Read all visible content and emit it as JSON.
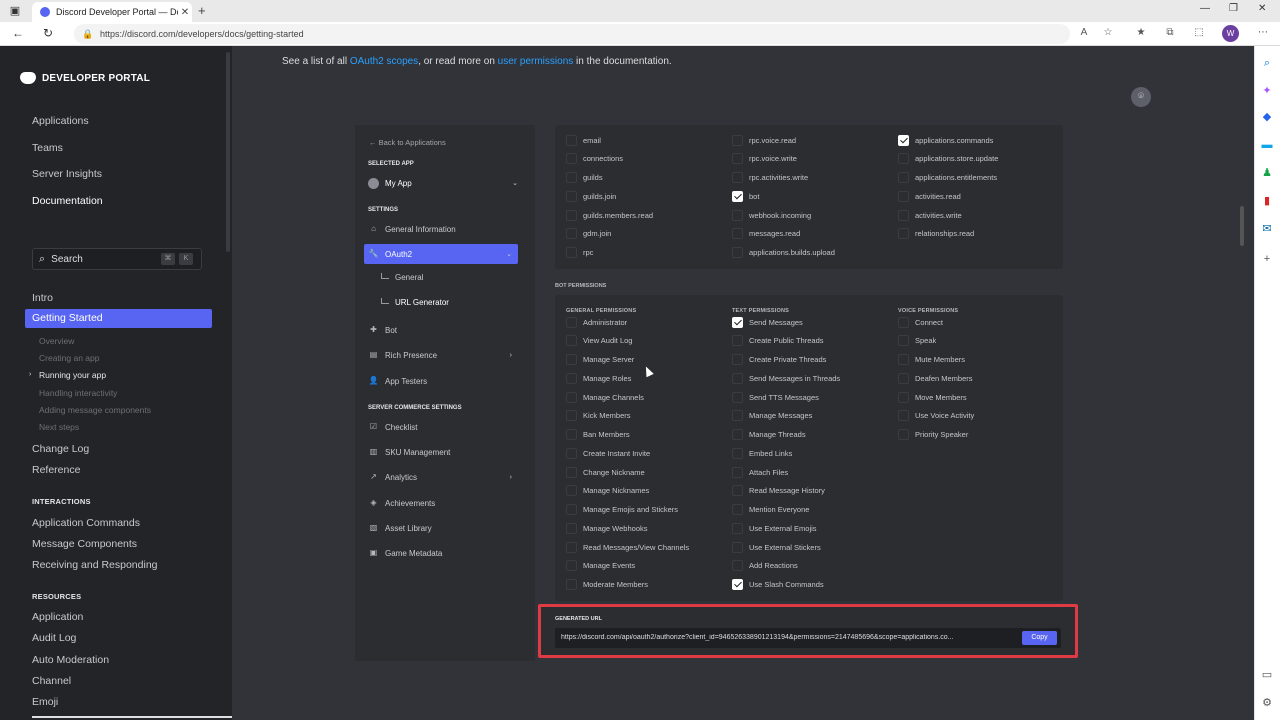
{
  "browser": {
    "tab_title": "Discord Developer Portal — Doc",
    "url": "https://discord.com/developers/docs/getting-started"
  },
  "sidebar": {
    "logo": "DEVELOPER PORTAL",
    "top_links": [
      "Applications",
      "Teams",
      "Server Insights",
      "Documentation"
    ],
    "search": {
      "placeholder": "Search",
      "kbd1": "⌘",
      "kbd2": "K"
    },
    "intro": "Intro",
    "active": "Getting Started",
    "sub_items": [
      "Overview",
      "Creating an app",
      "Running your app",
      "Handling interactivity",
      "Adding message components",
      "Next steps"
    ],
    "current_sub": "Running your app",
    "more_links": [
      "Change Log",
      "Reference"
    ],
    "interactions_heading": "INTERACTIONS",
    "interactions": [
      "Application Commands",
      "Message Components",
      "Receiving and Responding"
    ],
    "resources_heading": "RESOURCES",
    "resources": [
      "Application",
      "Audit Log",
      "Auto Moderation",
      "Channel",
      "Emoji"
    ]
  },
  "intro_line": {
    "pre": "See a list of all ",
    "link1": "OAuth2 scopes",
    "mid": ", or read more on ",
    "link2": "user permissions",
    "post": " in the documentation."
  },
  "app_nav": {
    "back": "Back to Applications",
    "selected_app_heading": "SELECTED APP",
    "app_name": "My App",
    "settings_heading": "SETTINGS",
    "general_information": "General Information",
    "oauth2": "OAuth2",
    "general": "General",
    "url_generator": "URL Generator",
    "bot": "Bot",
    "rich_presence": "Rich Presence",
    "app_testers": "App Testers",
    "commerce_heading": "SERVER COMMERCE SETTINGS",
    "checklist": "Checklist",
    "sku_management": "SKU Management",
    "analytics": "Analytics",
    "achievements": "Achievements",
    "asset_library": "Asset Library",
    "game_metadata": "Game Metadata"
  },
  "scopes": {
    "col1": [
      {
        "label": "email",
        "checked": false
      },
      {
        "label": "connections",
        "checked": false
      },
      {
        "label": "guilds",
        "checked": false
      },
      {
        "label": "guilds.join",
        "checked": false
      },
      {
        "label": "guilds.members.read",
        "checked": false
      },
      {
        "label": "gdm.join",
        "checked": false
      },
      {
        "label": "rpc",
        "checked": false
      }
    ],
    "col2": [
      {
        "label": "rpc.voice.read",
        "checked": false
      },
      {
        "label": "rpc.voice.write",
        "checked": false
      },
      {
        "label": "rpc.activities.write",
        "checked": false
      },
      {
        "label": "bot",
        "checked": true
      },
      {
        "label": "webhook.incoming",
        "checked": false
      },
      {
        "label": "messages.read",
        "checked": false
      },
      {
        "label": "applications.builds.upload",
        "checked": false
      }
    ],
    "col3": [
      {
        "label": "applications.commands",
        "checked": true
      },
      {
        "label": "applications.store.update",
        "checked": false
      },
      {
        "label": "applications.entitlements",
        "checked": false
      },
      {
        "label": "activities.read",
        "checked": false
      },
      {
        "label": "activities.write",
        "checked": false
      },
      {
        "label": "relationships.read",
        "checked": false
      }
    ]
  },
  "bot_permissions": {
    "heading": "BOT PERMISSIONS",
    "general_heading": "GENERAL PERMISSIONS",
    "text_heading": "TEXT PERMISSIONS",
    "voice_heading": "VOICE PERMISSIONS",
    "general": [
      {
        "label": "Administrator",
        "checked": false
      },
      {
        "label": "View Audit Log",
        "checked": false
      },
      {
        "label": "Manage Server",
        "checked": false
      },
      {
        "label": "Manage Roles",
        "checked": false
      },
      {
        "label": "Manage Channels",
        "checked": false
      },
      {
        "label": "Kick Members",
        "checked": false
      },
      {
        "label": "Ban Members",
        "checked": false
      },
      {
        "label": "Create Instant Invite",
        "checked": false
      },
      {
        "label": "Change Nickname",
        "checked": false
      },
      {
        "label": "Manage Nicknames",
        "checked": false
      },
      {
        "label": "Manage Emojis and Stickers",
        "checked": false
      },
      {
        "label": "Manage Webhooks",
        "checked": false
      },
      {
        "label": "Read Messages/View Channels",
        "checked": false
      },
      {
        "label": "Manage Events",
        "checked": false
      },
      {
        "label": "Moderate Members",
        "checked": false
      }
    ],
    "text": [
      {
        "label": "Send Messages",
        "checked": true
      },
      {
        "label": "Create Public Threads",
        "checked": false
      },
      {
        "label": "Create Private Threads",
        "checked": false
      },
      {
        "label": "Send Messages in Threads",
        "checked": false
      },
      {
        "label": "Send TTS Messages",
        "checked": false
      },
      {
        "label": "Manage Messages",
        "checked": false
      },
      {
        "label": "Manage Threads",
        "checked": false
      },
      {
        "label": "Embed Links",
        "checked": false
      },
      {
        "label": "Attach Files",
        "checked": false
      },
      {
        "label": "Read Message History",
        "checked": false
      },
      {
        "label": "Mention Everyone",
        "checked": false
      },
      {
        "label": "Use External Emojis",
        "checked": false
      },
      {
        "label": "Use External Stickers",
        "checked": false
      },
      {
        "label": "Add Reactions",
        "checked": false
      },
      {
        "label": "Use Slash Commands",
        "checked": true
      }
    ],
    "voice": [
      {
        "label": "Connect",
        "checked": false
      },
      {
        "label": "Speak",
        "checked": false
      },
      {
        "label": "Mute Members",
        "checked": false
      },
      {
        "label": "Deafen Members",
        "checked": false
      },
      {
        "label": "Move Members",
        "checked": false
      },
      {
        "label": "Use Voice Activity",
        "checked": false
      },
      {
        "label": "Priority Speaker",
        "checked": false
      }
    ]
  },
  "generated": {
    "label": "GENERATED URL",
    "url": "https://discord.com/api/oauth2/authorize?client_id=946526338901213194&permissions=2147485696&scope=applications.co...",
    "copy": "Copy"
  }
}
